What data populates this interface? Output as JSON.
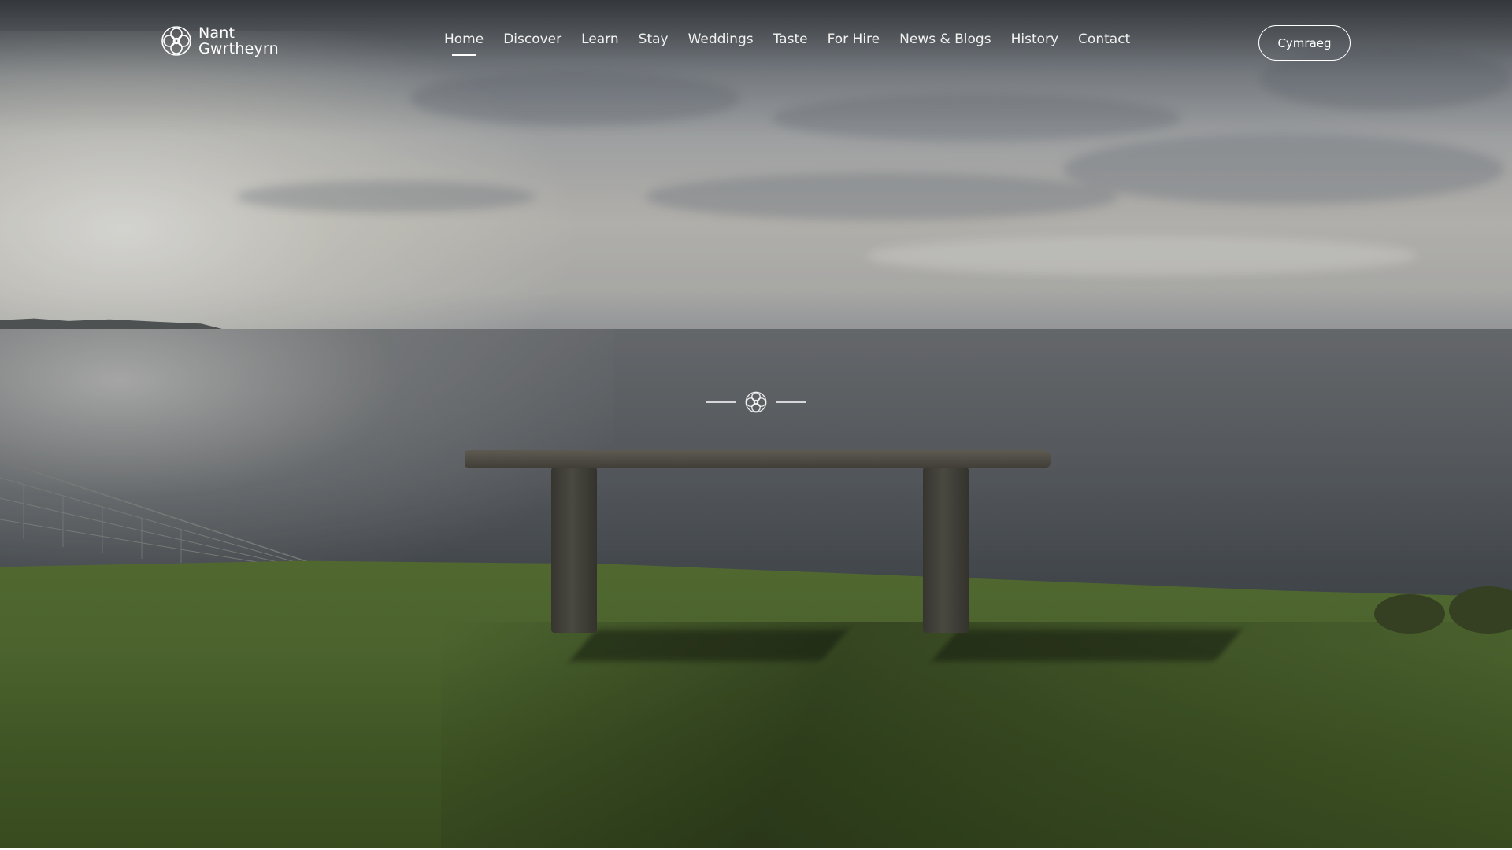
{
  "site": {
    "logo_line1": "Nant",
    "logo_line2": "Gwrtheyrn",
    "logo_icon": "celtic-knot-icon"
  },
  "nav": {
    "items": [
      {
        "label": "Home",
        "active": true
      },
      {
        "label": "Discover",
        "active": false
      },
      {
        "label": "Learn",
        "active": false
      },
      {
        "label": "Stay",
        "active": false
      },
      {
        "label": "Weddings",
        "active": false
      },
      {
        "label": "Taste",
        "active": false
      },
      {
        "label": "For Hire",
        "active": false
      },
      {
        "label": "News & Blogs",
        "active": false
      },
      {
        "label": "History",
        "active": false
      },
      {
        "label": "Contact",
        "active": false
      }
    ]
  },
  "language_button": {
    "label": "Cymraeg"
  },
  "hero": {
    "image": "stone bench on grass overlooking the sea",
    "emblem_icon": "celtic-knot-icon"
  },
  "colors": {
    "nav_text": "#f1f1ef",
    "button_border": "#ffffff"
  }
}
